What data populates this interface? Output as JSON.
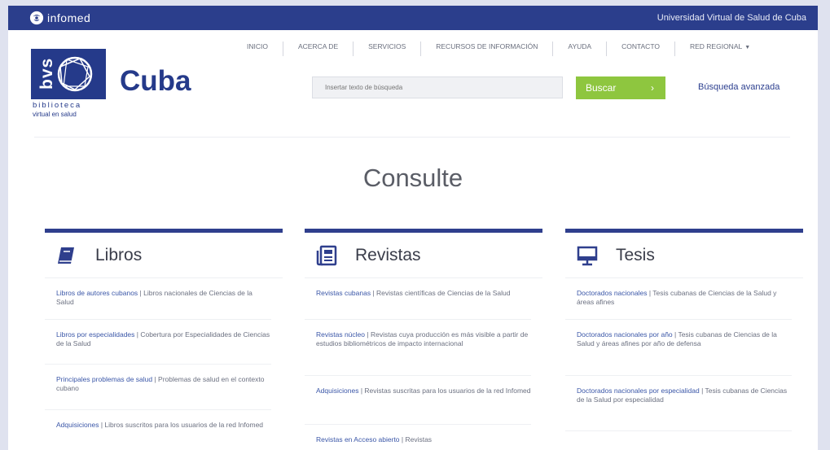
{
  "topbar": {
    "brand": "infomed",
    "right_link": "Universidad Virtual de Salud de Cuba"
  },
  "nav": [
    {
      "label": "INICIO"
    },
    {
      "label": "ACERCA DE"
    },
    {
      "label": "SERVICIOS"
    },
    {
      "label": "RECURSOS DE INFORMACIÓN"
    },
    {
      "label": "AYUDA"
    },
    {
      "label": "CONTACTO"
    },
    {
      "label": "RED REGIONAL"
    }
  ],
  "logo": {
    "bvs": "bvs",
    "country": "Cuba",
    "sub1": "biblioteca",
    "sub2": "virtual en salud"
  },
  "search": {
    "placeholder": "Insertar texto de búsqueda",
    "button": "Buscar",
    "button_arrow": "›",
    "advanced": "Búsqueda avanzada"
  },
  "main": {
    "heading": "Consulte"
  },
  "columns": [
    {
      "title": "Libros",
      "icon": "book-icon",
      "items": [
        {
          "link": "Libros de autores cubanos",
          "text": " | Libros nacionales de Ciencias de la Salud"
        },
        {
          "link": "Libros por especialidades",
          "text": " | Cobertura por Especialidades de Ciencias de la Salud"
        },
        {
          "link": "Principales problemas de salud",
          "text": " | Problemas de salud en el contexto cubano"
        },
        {
          "link": "Adquisiciones",
          "text": " | Libros suscritos para los usuarios de la red Infomed"
        }
      ]
    },
    {
      "title": "Revistas",
      "icon": "newspaper-icon",
      "items": [
        {
          "link": "Revistas cubanas",
          "text": " | Revistas científicas de Ciencias de la Salud"
        },
        {
          "link": "Revistas núcleo",
          "text": " | Revistas cuya producción es más visible a partir de estudios bibliométricos de impacto internacional"
        },
        {
          "link": "Adquisiciones",
          "text": " | Revistas suscritas para los usuarios de la red Infomed"
        },
        {
          "link": "Revistas en Acceso abierto",
          "text": " | Revistas"
        }
      ]
    },
    {
      "title": "Tesis",
      "icon": "monitor-icon",
      "items": [
        {
          "link": "Doctorados nacionales",
          "text": " | Tesis cubanas de Ciencias de la Salud y áreas afines"
        },
        {
          "link": "Doctorados nacionales por año",
          "text": " | Tesis cubanas de Ciencias de la Salud y áreas afines por año de defensa"
        },
        {
          "link": "Doctorados nacionales por especialidad",
          "text": " | Tesis cubanas de Ciencias de la Salud por especialidad"
        }
      ]
    }
  ],
  "colors": {
    "topbar": "#2b3e8c",
    "brand_blue": "#253a8a",
    "button_green": "#8ec63f",
    "link_blue": "#3b57a8"
  }
}
